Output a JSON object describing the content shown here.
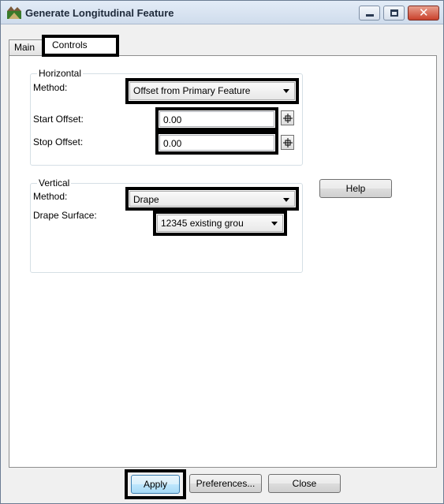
{
  "window": {
    "title": "Generate Longitudinal Feature"
  },
  "tabs": [
    {
      "label": "Main"
    },
    {
      "label": "Controls",
      "selected": true
    }
  ],
  "horizontal": {
    "legend": "Horizontal",
    "method_label": "Method:",
    "method_value": "Offset from Primary Feature",
    "start_offset_label": "Start Offset:",
    "start_offset_value": "0.00",
    "stop_offset_label": "Stop Offset:",
    "stop_offset_value": "0.00"
  },
  "vertical": {
    "legend": "Vertical",
    "method_label": "Method:",
    "method_value": "Drape",
    "drape_surface_label": "Drape Surface:",
    "drape_surface_value": "12345 existing grou"
  },
  "buttons": {
    "help": "Help",
    "apply": "Apply",
    "preferences": "Preferences...",
    "close": "Close"
  },
  "colors": {
    "highlight_border": "#000000",
    "titlebar": "#d6e2f0",
    "close_button": "#c9412c"
  }
}
